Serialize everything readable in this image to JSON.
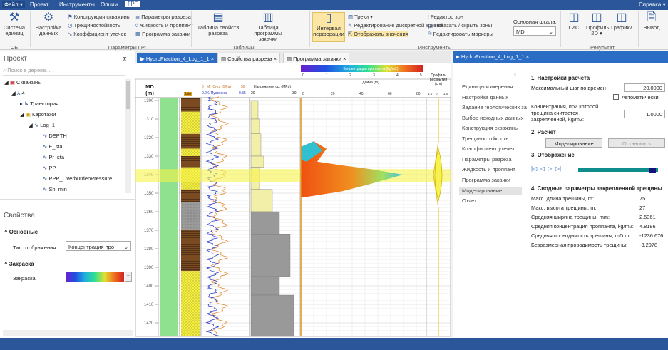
{
  "menu": {
    "items": [
      "Файл ▾",
      "Проект",
      "Инструменты",
      "Опции",
      "ГРП"
    ],
    "help": "Справка ▾"
  },
  "ribbon": {
    "system_units": "Система единиц",
    "settings_data": "Настройка данных",
    "well_design": "Конструкция скважины",
    "fracturing": "Трещиностойкость",
    "leakoff": "Коэффициент утечек",
    "section_params": "Параметры разреза",
    "fluid_proppant": "Жидкость и проппант",
    "pump_program": "Программа закачки",
    "group_ce": "СЕ",
    "group_params": "Параметры ГРП",
    "table_section": "Таблица свойств разреза",
    "table_pump": "Таблица программы закачки",
    "group_tables": "Таблицы",
    "perf_interval": "Интервал перфорации",
    "tracks": "Треки ▾",
    "edit_discrete": "Редактирование дискретной кривой",
    "show_values": "Отображать значения",
    "zone_editor": "Редактор зон",
    "show_hide_zones": "Показать / скрыть зоны",
    "edit_markers": "Редактировать маркеры",
    "main_scale_label": "Основная шкала:",
    "main_scale_value": "MD",
    "group_tools": "Инструменты",
    "gis": "ГИС",
    "profile2d": "Профиль 2D ▾",
    "graphs": "Графики",
    "output": "Вывод",
    "group_result": "Результат"
  },
  "left": {
    "project_title": "Проект",
    "search_placeholder": "Поиск в дереве...",
    "tree": [
      "Скважины",
      "4",
      "Траектория",
      "Каротажи",
      "Log_1",
      "DEPTH",
      "E_sta",
      "Pr_sta",
      "PP",
      "PPP_OverburdenPressure",
      "Sh_min"
    ],
    "props_title": "Свойства",
    "basic": "Основные",
    "display_type_label": "Тип отображения",
    "display_type_value": "Концентрация про",
    "fill_section": "Закраска",
    "fill_label": "Закраска"
  },
  "tabs": {
    "t1": "HydroFraction_4_Log_1_1",
    "t2": "Свойства разреза",
    "t3": "Программа закачки",
    "right": "HydroFraction_4_Log_1_1"
  },
  "chart": {
    "md_label": "MD",
    "md_unit": "(m)",
    "litho": "Lito",
    "young": "М. Юнга (GPa)",
    "poisson": "К. Пуассона",
    "young_range": [
      "0",
      "50"
    ],
    "poisson_range": [
      "0.2",
      "0.35"
    ],
    "stress": "Напряжение ср. (MPa)",
    "stress_range": [
      "20",
      "30"
    ],
    "conc_title": "Концентрация проппанта (kg/m2)",
    "conc_ticks": [
      "0",
      "1",
      "2",
      "3",
      "4",
      "5"
    ],
    "length": "Длина (m)",
    "length_ticks": [
      "0",
      "20",
      "40",
      "60",
      "80"
    ],
    "profile": "Профиль раскрытия (cm)",
    "profile_ticks": [
      "1.0",
      "0",
      "1.0"
    ],
    "depths": [
      "1300",
      "1310",
      "1320",
      "1330",
      "1340",
      "1350",
      "1360",
      "1370",
      "1380",
      "1390",
      "1400",
      "1410",
      "1420"
    ]
  },
  "right": {
    "nav": [
      "Единицы измерения",
      "Настройка данных",
      "Задание геологических за",
      "Выбор исходных данных",
      "Конструкция скважины",
      "Трещиностойкость",
      "Коэффициент утечек",
      "Параметры разреза",
      "Жидкость и проппант",
      "Программа закачки",
      "Моделирование",
      "Отчет"
    ],
    "nav_back": "‹",
    "s1": "1. Настройки расчета",
    "max_step_label": "Максимальный шаг по времен",
    "max_step_value": "20.0000",
    "auto_label": "Автоматически",
    "conc_label": "Концентрация, при которой трещина считается закрепленной, kg/m2:",
    "conc_value": "1.0000",
    "s2": "2. Расчет",
    "simulate": "Моделирование",
    "stop": "Остановить",
    "s3": "3. Отображение",
    "player": [
      "|◁",
      "◁",
      "▷",
      "▷|"
    ],
    "progress": 1.0,
    "s4": "4. Сводные параметры закрепленной трещины",
    "results": [
      {
        "label": "Макс. длина трещины, m:",
        "value": "75"
      },
      {
        "label": "Макс. высота трещины, m:",
        "value": "27"
      },
      {
        "label": "Средняя ширина трещины, mm:",
        "value": "2.5361"
      },
      {
        "label": "Средняя концентрация проппанта, kg/m2:",
        "value": "4.8186"
      },
      {
        "label": "Средняя проводимость трещины, mD.m:",
        "value": "-1236.676"
      },
      {
        "label": "Безразмерная проводимость трещины:",
        "value": "-3.2978"
      }
    ]
  },
  "colors": {
    "accent": "#2b579a",
    "tab_active": "#2b6cc4",
    "highlight": "#f7f34a",
    "progress": "#0f8c8c"
  }
}
